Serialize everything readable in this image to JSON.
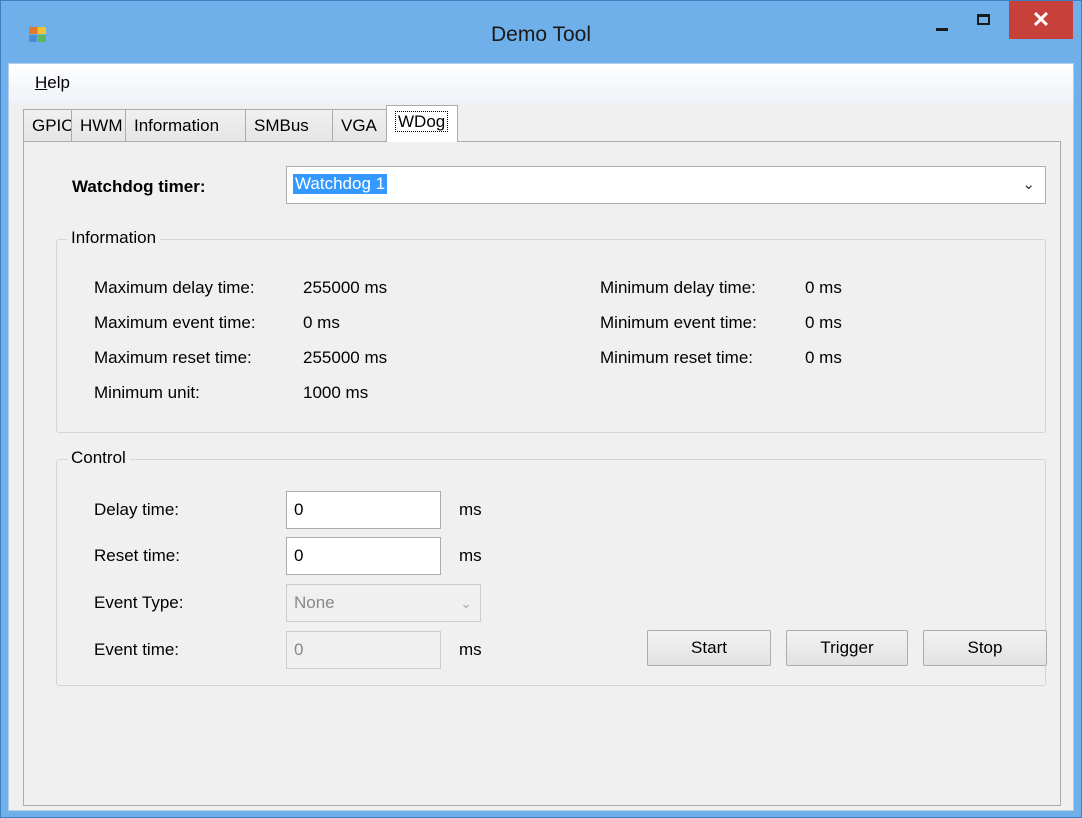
{
  "window": {
    "title": "Demo Tool",
    "close_glyph": "✕"
  },
  "menu": {
    "help_accel": "H",
    "help_rest": "elp"
  },
  "tabs": [
    "GPIO",
    "HWM",
    "Information",
    "SMBus",
    "VGA",
    "WDog"
  ],
  "active_tab": "WDog",
  "watchdog": {
    "label": "Watchdog timer:",
    "selected": "Watchdog 1",
    "arrow": "⌄"
  },
  "information": {
    "title": "Information",
    "max_delay_label": "Maximum delay time:",
    "max_delay_value": "255000 ms",
    "max_event_label": "Maximum event time:",
    "max_event_value": "0 ms",
    "max_reset_label": "Maximum reset time:",
    "max_reset_value": "255000 ms",
    "min_unit_label": "Minimum unit:",
    "min_unit_value": "1000 ms",
    "min_delay_label": "Minimum delay time:",
    "min_delay_value": "0 ms",
    "min_event_label": "Minimum event time:",
    "min_event_value": "0 ms",
    "min_reset_label": "Minimum reset time:",
    "min_reset_value": "0 ms"
  },
  "control": {
    "title": "Control",
    "delay_label": "Delay time:",
    "delay_value": "0",
    "delay_unit": "ms",
    "reset_label": "Reset time:",
    "reset_value": "0",
    "reset_unit": "ms",
    "event_type_label": "Event Type:",
    "event_type_value": "None",
    "event_time_label": "Event time:",
    "event_time_value": "0",
    "event_time_unit": "ms",
    "start_label": "Start",
    "trigger_label": "Trigger",
    "stop_label": "Stop"
  },
  "colors": {
    "titlebar": "#6fb0ea",
    "close": "#c7403a",
    "selection": "#3399ff"
  }
}
